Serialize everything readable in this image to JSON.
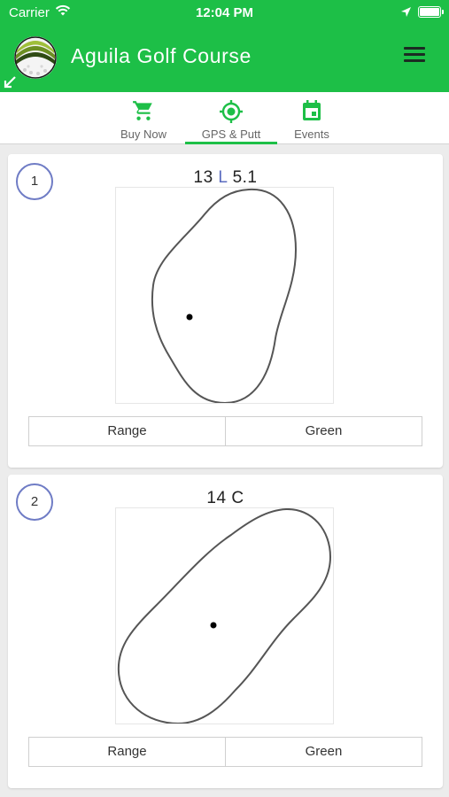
{
  "statusbar": {
    "carrier": "Carrier",
    "time": "12:04 PM"
  },
  "app": {
    "title": "Aguila Golf Course"
  },
  "tabs": [
    {
      "label": "Buy Now",
      "icon": "cart-icon"
    },
    {
      "label": "GPS & Putt",
      "icon": "gps-target-icon",
      "active": true
    },
    {
      "label": "Events",
      "icon": "calendar-icon"
    }
  ],
  "holes": [
    {
      "number": "1",
      "dist_a": "13",
      "lr": "L",
      "dist_b": "5.1",
      "range_label": "Range",
      "green_label": "Green"
    },
    {
      "number": "2",
      "dist_a": "14",
      "lr": "C",
      "dist_b": "",
      "range_label": "Range",
      "green_label": "Green"
    }
  ],
  "colors": {
    "header_green": "#1dbf47",
    "badge_blue": "#6f7cc5",
    "lr_blue": "#5a6bbf"
  }
}
